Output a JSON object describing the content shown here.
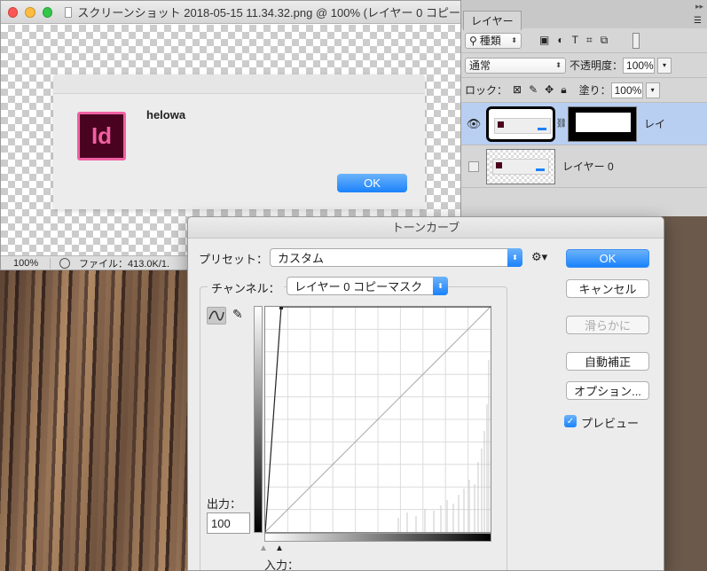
{
  "preview_window": {
    "title": "スクリーンショット 2018-05-15 11.34.32.png @ 100% (レイヤー 0 コピー",
    "alert": {
      "app_icon_text": "Id",
      "message": "helowa",
      "ok_label": "OK"
    },
    "statusbar": {
      "zoom": "100%",
      "file_info": "ファイル：413.0K/1."
    }
  },
  "layers_panel": {
    "tab_label": "レイヤー",
    "filter_label": "種類",
    "blend_mode": "通常",
    "opacity_label": "不透明度：",
    "opacity_value": "100%",
    "lock_label": "ロック：",
    "fill_label": "塗り：",
    "fill_value": "100%",
    "layers": [
      {
        "name": "レイ",
        "selected": true,
        "visible": true
      },
      {
        "name": "レイヤー 0",
        "selected": false,
        "visible": false
      }
    ]
  },
  "curves_dialog": {
    "title": "トーンカーブ",
    "preset_label": "プリセット：",
    "preset_value": "カスタム",
    "channel_label": "チャンネル：",
    "channel_value": "レイヤー 0 コピーマスク",
    "buttons": {
      "ok": "OK",
      "cancel": "キャンセル",
      "smooth": "滑らかに",
      "auto": "自動補正",
      "options": "オプション..."
    },
    "preview_label": "プレビュー",
    "preview_checked": true,
    "output_label": "出力：",
    "output_value": "100",
    "input_label": "入力："
  },
  "colors": {
    "accent": "#1a82fb",
    "indesign_bg": "#49021f",
    "indesign_fg": "#f060a3",
    "layer_selected": "#b8cff2"
  }
}
